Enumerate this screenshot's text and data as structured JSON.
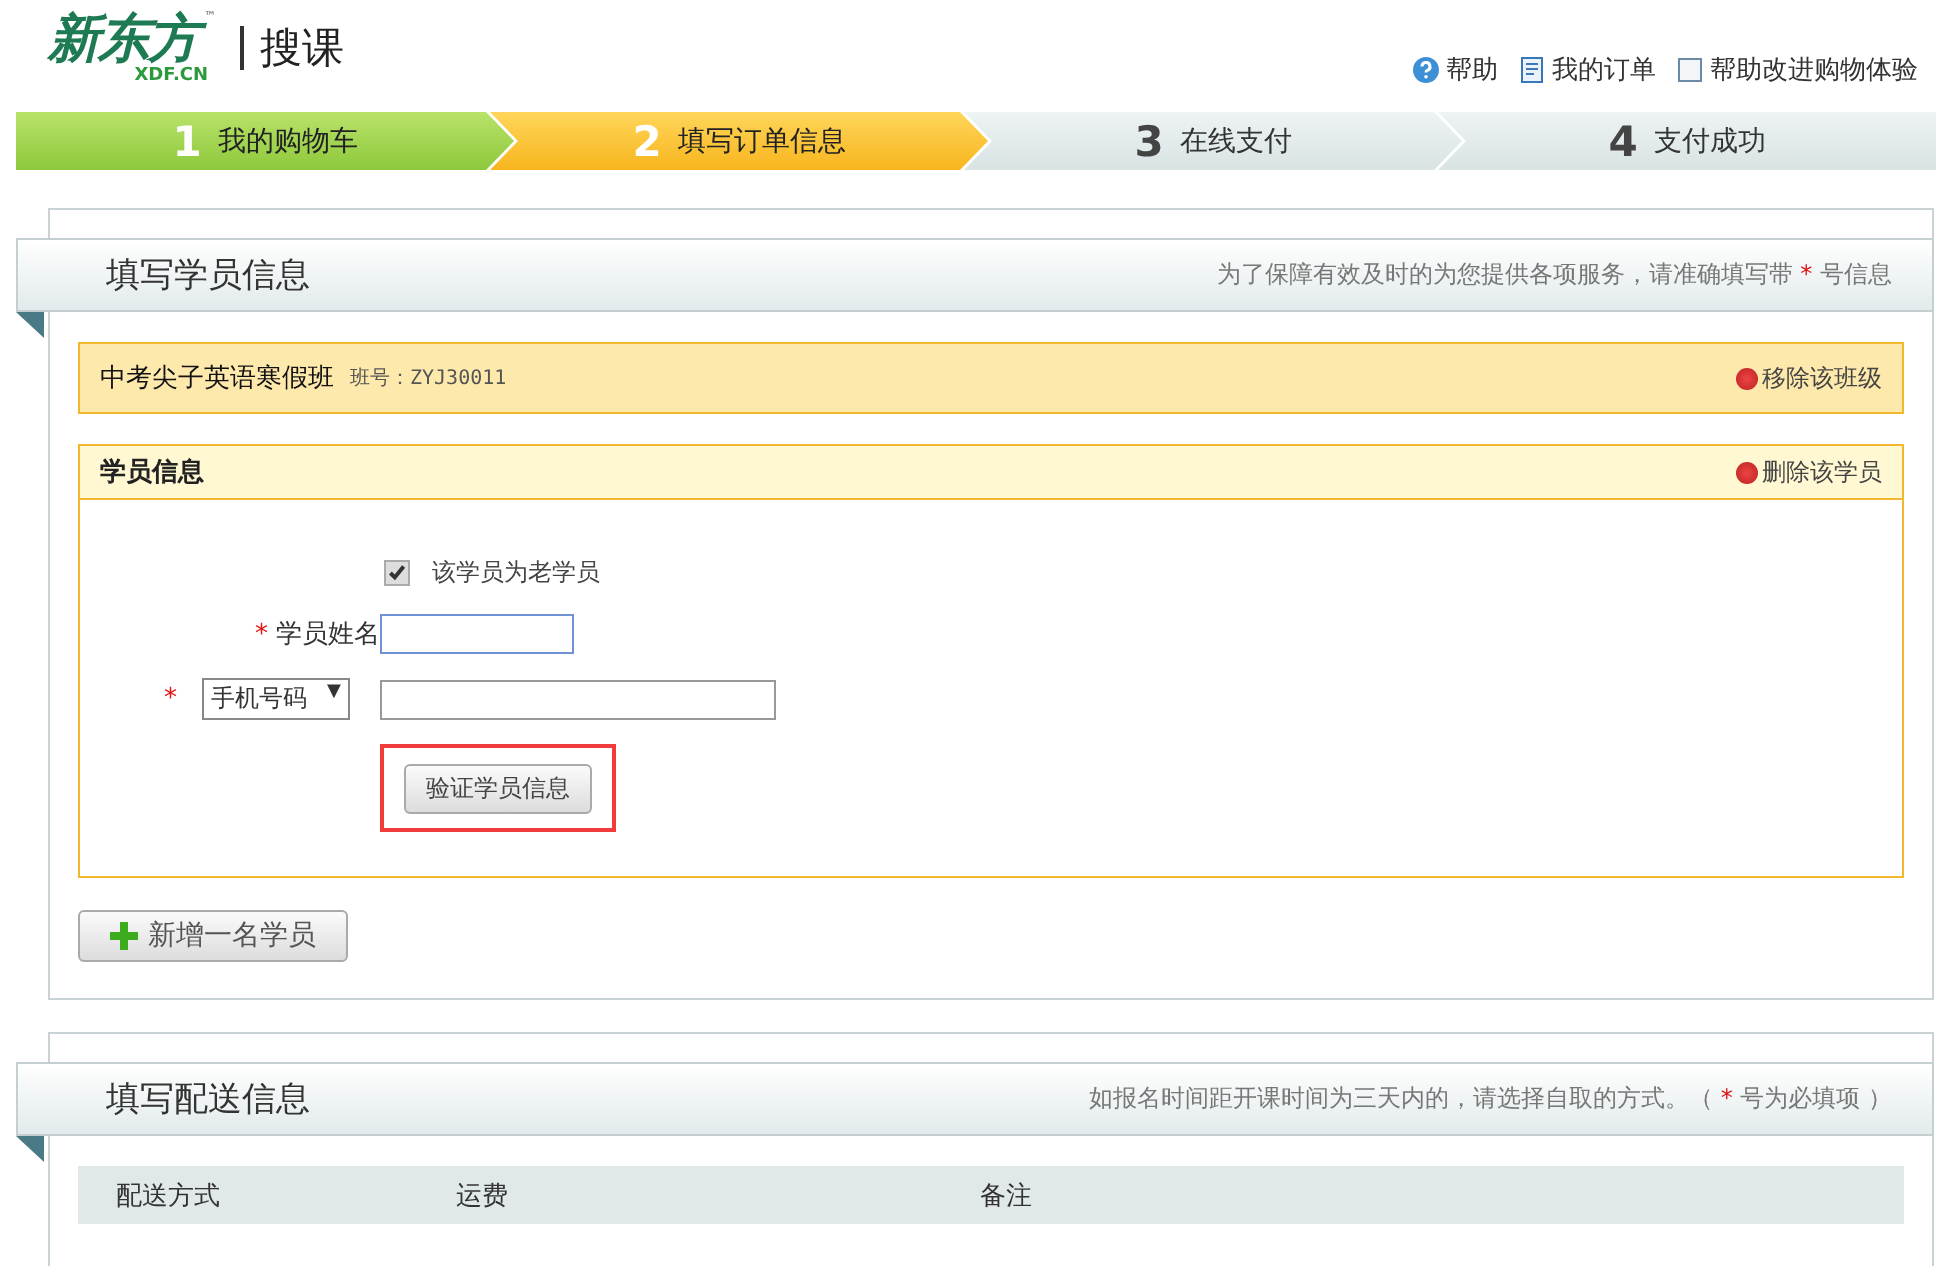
{
  "header": {
    "logo": "新东方",
    "logo_sub": "XDF.CN",
    "logo_tm": "™",
    "site": "搜课",
    "links": [
      {
        "kind": "help",
        "label": "帮助"
      },
      {
        "kind": "orders",
        "label": "我的订单"
      },
      {
        "kind": "feedback",
        "label": "帮助改进购物体验"
      }
    ]
  },
  "steps": [
    {
      "number": "1",
      "label": "我的购物车",
      "kind": "done"
    },
    {
      "number": "2",
      "label": "填写订单信息",
      "kind": "current"
    },
    {
      "number": "3",
      "label": "在线支付",
      "kind": "pending"
    },
    {
      "number": "4",
      "label": "支付成功",
      "kind": "pending"
    }
  ],
  "student_section": {
    "title": "填写学员信息",
    "hint": {
      "before": "为了保障有效及时的为您提供各项服务，请准确填写带 ",
      "mark": "*",
      "after": " 号信息"
    },
    "class_bar": {
      "name": "中考尖子英语寒假班",
      "code": "班号：ZYJ30011",
      "remove": "移除该班级"
    },
    "student_panel": {
      "title": "学员信息",
      "delete": "删除该学员",
      "old_student": {
        "label": "该学员为老学员",
        "checked": true
      },
      "name_field": {
        "mark": "*",
        "label": "学员姓名"
      },
      "contact_field": {
        "mark": "*",
        "type": "手机号码",
        "arrow": "▼"
      },
      "verify_button": "验证学员信息",
      "highlighted": true
    },
    "add_button": "新增一名学员"
  },
  "delivery_section": {
    "title": "填写配送信息",
    "hint": {
      "before": "如报名时间距开课时间为三天内的，请选择自取的方式。（ ",
      "mark": "*",
      "after": " 号为必填项 ）"
    },
    "columns": [
      "配送方式",
      "运费",
      "备注"
    ]
  }
}
